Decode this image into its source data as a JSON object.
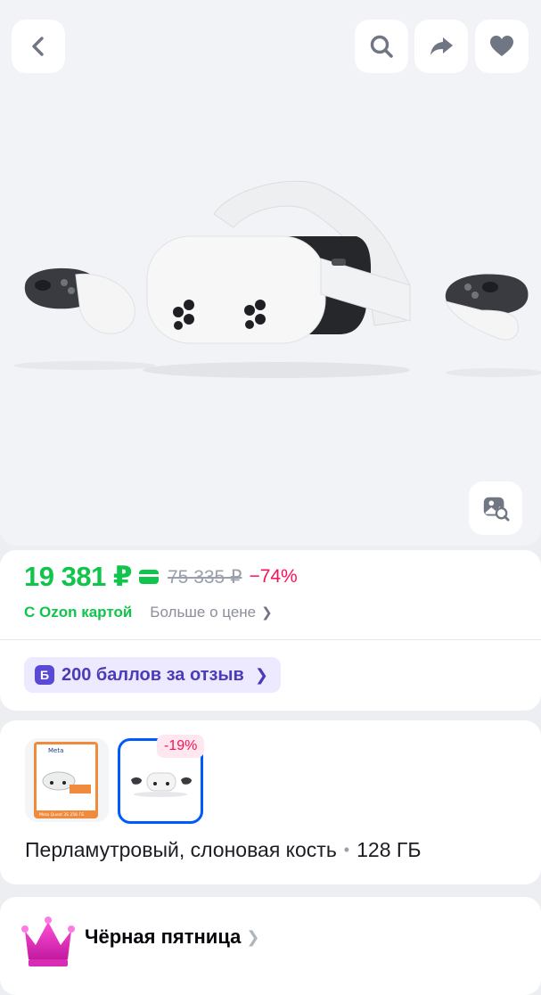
{
  "header": {
    "back_icon": "chevron-left-icon",
    "search_icon": "search-icon",
    "share_icon": "share-arrow-icon",
    "favorite_icon": "heart-icon"
  },
  "photo": {
    "lens_icon": "image-search-icon"
  },
  "price": {
    "current": "19 381 ₽",
    "card_icon": "ozon-card-icon",
    "old": "75 335 ₽",
    "discount": "−74%",
    "ozon_card_label": "С Ozon картой",
    "more_label": "Больше о цене",
    "points_icon_letter": "Б",
    "points_label": "200 баллов за отзыв"
  },
  "variants": {
    "discount_tag": "-19%",
    "selected_color": "Перламутровый, слоновая кость",
    "separator": "•",
    "storage": "128 ГБ",
    "thumb_1_brand": "Meta",
    "thumb_1_caption": "Meta Quest 3S   256 ГБ"
  },
  "promo": {
    "icon": "crown-icon",
    "title": "Чёрная пятница"
  },
  "colors": {
    "price_green": "#10c44c",
    "discount_pink": "#f91155",
    "accent_blue": "#005bff",
    "points_purple": "#5a48d6"
  }
}
